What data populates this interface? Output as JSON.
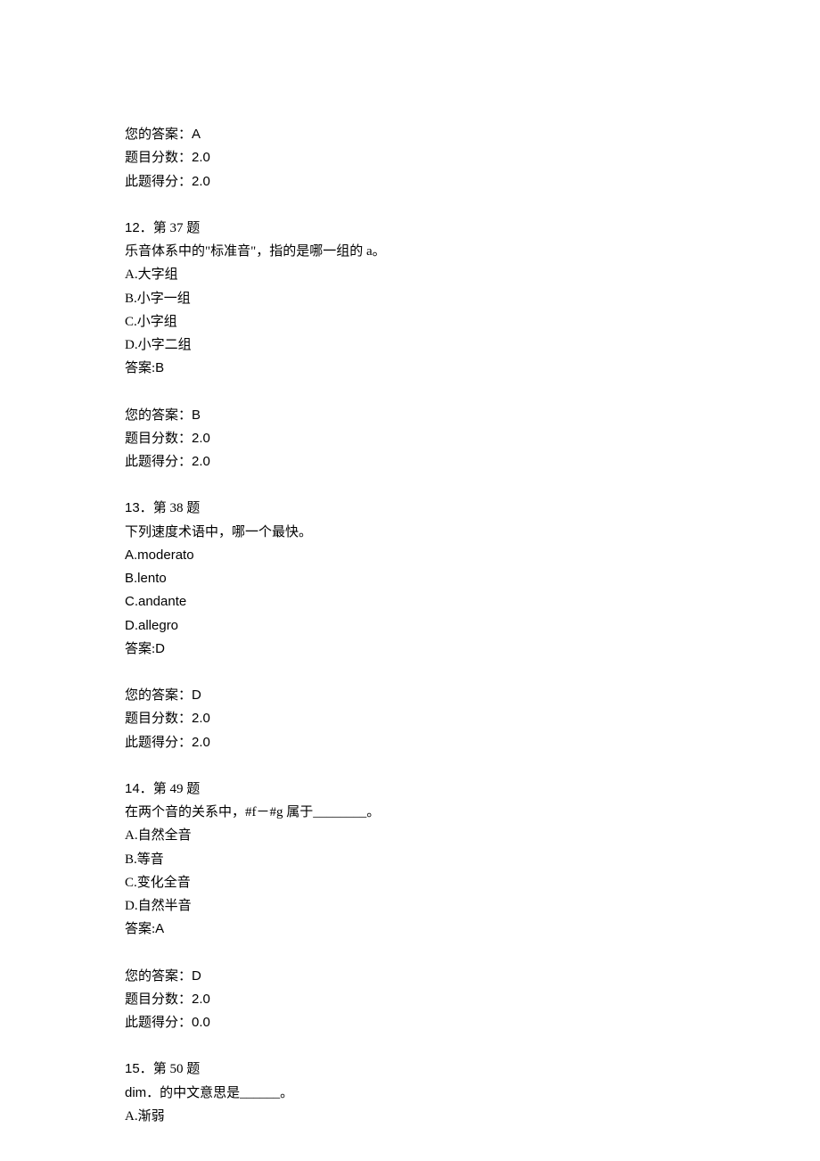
{
  "q11_tail": {
    "your_answer_label": "您的答案：",
    "your_answer_value": "A",
    "score_label": "题目分数：",
    "score_value": "2.0",
    "got_label": "此题得分：",
    "got_value": "2.0"
  },
  "q12": {
    "index": "12．",
    "title": "第 37 题",
    "stem": "乐音体系中的\"标准音\"，指的是哪一组的 a。",
    "opt_a": "A.大字组",
    "opt_b": "B.小字一组",
    "opt_c": "C.小字组",
    "opt_d": "D.小字二组",
    "ans_label": "答案:",
    "ans_value": "B",
    "your_answer_label": "您的答案：",
    "your_answer_value": "B",
    "score_label": "题目分数：",
    "score_value": "2.0",
    "got_label": "此题得分：",
    "got_value": "2.0"
  },
  "q13": {
    "index": "13．",
    "title": "第 38 题",
    "stem": "下列速度术语中，哪一个最快。",
    "opt_a": "A.moderato",
    "opt_b": "B.lento",
    "opt_c": "C.andante",
    "opt_d": "D.allegro",
    "ans_label": "答案:",
    "ans_value": "D",
    "your_answer_label": "您的答案：",
    "your_answer_value": "D",
    "score_label": "题目分数：",
    "score_value": "2.0",
    "got_label": "此题得分：",
    "got_value": "2.0"
  },
  "q14": {
    "index": "14．",
    "title": "第 49 题",
    "stem": "在两个音的关系中，#f－#g 属于________。",
    "opt_a": "A.自然全音",
    "opt_b": "B.等音",
    "opt_c": "C.变化全音",
    "opt_d": "D.自然半音",
    "ans_label": "答案:",
    "ans_value": "A",
    "your_answer_label": "您的答案：",
    "your_answer_value": "D",
    "score_label": "题目分数：",
    "score_value": "2.0",
    "got_label": "此题得分：",
    "got_value": "0.0"
  },
  "q15": {
    "index": "15．",
    "title": "第 50 题",
    "stem_prefix": "dim．",
    "stem_suffix": "的中文意思是______。",
    "opt_a": "A.渐弱"
  }
}
